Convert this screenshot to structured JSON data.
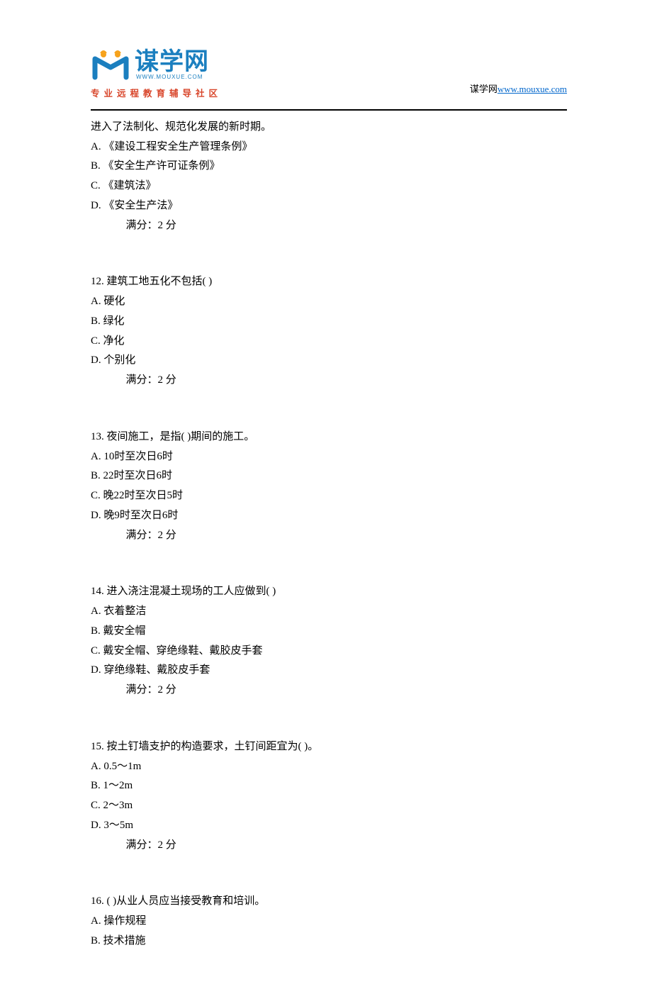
{
  "header": {
    "brand_main": "谋学网",
    "brand_url_small": "WWW.MOUXUE.COM",
    "tagline": "专业远程教育辅导社区",
    "right_label": "谋学网",
    "right_url": "www.mouxue.com"
  },
  "q11": {
    "stem_cont": "进入了法制化、规范化发展的新时期。",
    "optA": "A. 《建设工程安全生产管理条例》",
    "optB": "B. 《安全生产许可证条例》",
    "optC": "C. 《建筑法》",
    "optD": "D. 《安全生产法》",
    "score": "满分：2  分"
  },
  "q12": {
    "stem": "12.  建筑工地五化不包括( )",
    "optA": "A. 硬化",
    "optB": "B. 绿化",
    "optC": "C. 净化",
    "optD": "D. 个别化",
    "score": "满分：2  分"
  },
  "q13": {
    "stem": "13.  夜间施工，是指( )期间的施工。",
    "optA": "A. 10时至次日6时",
    "optB": "B. 22时至次日6时",
    "optC": "C. 晚22时至次日5时",
    "optD": "D. 晚9时至次日6时",
    "score": "满分：2  分"
  },
  "q14": {
    "stem": "14.  进入浇注混凝土现场的工人应做到( )",
    "optA": "A. 衣着整洁",
    "optB": "B. 戴安全帽",
    "optC": "C. 戴安全帽、穿绝缘鞋、戴胶皮手套",
    "optD": "D. 穿绝缘鞋、戴胶皮手套",
    "score": "满分：2  分"
  },
  "q15": {
    "stem": "15.  按土钉墙支护的构造要求，土钉间距宜为( )。",
    "optA": "A. 0.5～1m",
    "optB": "B. 1～2m",
    "optC": "C. 2～3m",
    "optD": "D. 3～5m",
    "score": "满分：2  分"
  },
  "q16": {
    "stem": "16.  ( )从业人员应当接受教育和培训。",
    "optA": "A. 操作规程",
    "optB": "B. 技术措施"
  }
}
